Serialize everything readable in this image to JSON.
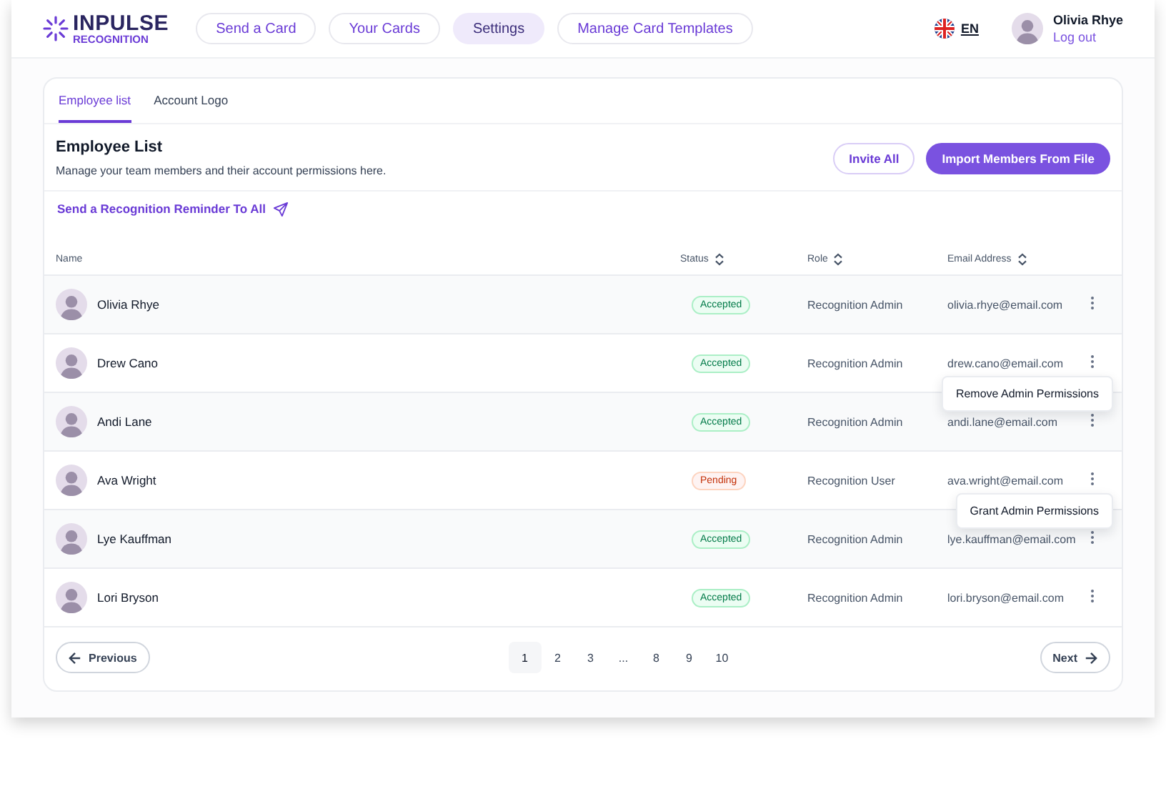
{
  "header": {
    "logo": {
      "title": "INPULSE",
      "subtitle": "RECOGNITION"
    },
    "nav": [
      {
        "label": "Send a Card",
        "selected": false
      },
      {
        "label": "Your Cards",
        "selected": false
      },
      {
        "label": "Settings",
        "selected": true
      },
      {
        "label": "Manage Card Templates",
        "selected": false
      }
    ],
    "language": "EN",
    "user": {
      "name": "Olivia Rhye",
      "action": "Log out"
    }
  },
  "tabs": [
    {
      "label": "Employee list",
      "selected": true
    },
    {
      "label": "Account Logo",
      "selected": false
    }
  ],
  "section": {
    "title": "Employee List",
    "description": "Manage your team members and their account permissions here.",
    "buttons": [
      {
        "label": "Invite All",
        "kind": "secondary"
      },
      {
        "label": "Import Members From File",
        "kind": "primary"
      }
    ]
  },
  "reminder_link": "Send a Recognition Reminder To All",
  "table": {
    "columns": [
      {
        "label": "Name",
        "sortable": false
      },
      {
        "label": "Status",
        "sortable": true
      },
      {
        "label": "Role",
        "sortable": true
      },
      {
        "label": "Email Address",
        "sortable": true
      }
    ],
    "rows": [
      {
        "name": "Olivia Rhye",
        "status": {
          "text": "Accepted",
          "kind": "accepted"
        },
        "role": "Recognition Admin",
        "email": "olivia.rhye@email.com"
      },
      {
        "name": "Drew Cano",
        "status": {
          "text": "Accepted",
          "kind": "accepted"
        },
        "role": "Recognition Admin",
        "email": "drew.cano@email.com",
        "menu_item": "Remove Admin Permissions"
      },
      {
        "name": "Andi Lane",
        "status": {
          "text": "Accepted",
          "kind": "accepted"
        },
        "role": "Recognition Admin",
        "email": "andi.lane@email.com"
      },
      {
        "name": "Ava Wright",
        "status": {
          "text": "Pending",
          "kind": "pending"
        },
        "role": "Recognition User",
        "email": "ava.wright@email.com",
        "menu_item": "Grant Admin Permissions"
      },
      {
        "name": "Lye Kauffman",
        "status": {
          "text": "Accepted",
          "kind": "accepted"
        },
        "role": "Recognition Admin",
        "email": "lye.kauffman@email.com"
      },
      {
        "name": "Lori Bryson",
        "status": {
          "text": "Accepted",
          "kind": "accepted"
        },
        "role": "Recognition Admin",
        "email": "lori.bryson@email.com"
      }
    ]
  },
  "pagination": {
    "previous": "Previous",
    "next": "Next",
    "pages": [
      {
        "label": "1",
        "selected": true
      },
      {
        "label": "2",
        "selected": false
      },
      {
        "label": "3",
        "selected": false
      },
      {
        "label": "...",
        "selected": false
      },
      {
        "label": "8",
        "selected": false
      },
      {
        "label": "9",
        "selected": false
      },
      {
        "label": "10",
        "selected": false
      }
    ]
  }
}
